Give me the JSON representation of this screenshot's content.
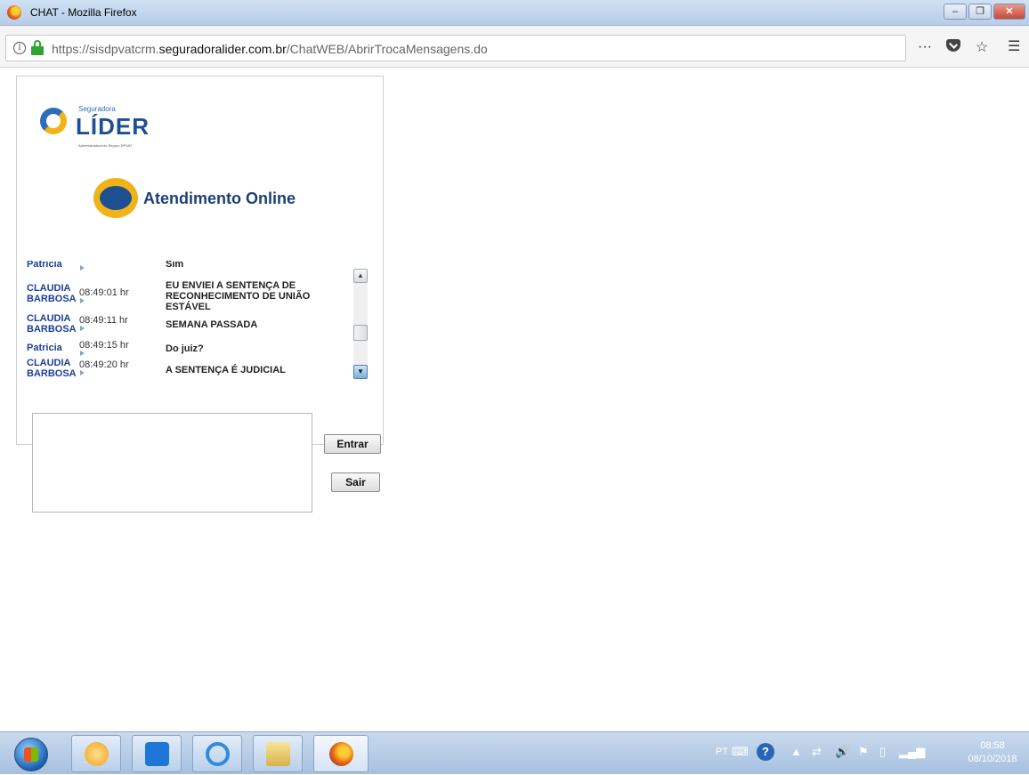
{
  "window": {
    "title": "CHAT - Mozilla Firefox",
    "minimize": "–",
    "maximize": "❐",
    "close": "✕"
  },
  "address_bar": {
    "url_prefix": "https://sisdpvatcrm.",
    "url_domain": "seguradoralider.com.br",
    "url_path": "/ChatWEB/AbrirTrocaMensagens.do",
    "more": "···",
    "star": "☆",
    "menu": "☰"
  },
  "logo": {
    "small": "Seguradora",
    "big": "LÍDER",
    "tag": "Administradora do Seguro DPVAT"
  },
  "heading": "Atendimento Online",
  "messages": [
    {
      "sender": "Patricia",
      "time": "",
      "text": "Sim"
    },
    {
      "sender": "CLAUDIA BARBOSA",
      "time": "08:49:01 hr",
      "text": "EU ENVIEI A SENTENÇA DE RECONHECIMENTO DE UNIÃO ESTÁVEL"
    },
    {
      "sender": "CLAUDIA BARBOSA",
      "time": "08:49:11 hr",
      "text": "SEMANA PASSADA"
    },
    {
      "sender": "Patricia",
      "time": "08:49:15 hr",
      "text": "Do juiz?"
    },
    {
      "sender": "CLAUDIA BARBOSA",
      "time": "08:49:20 hr",
      "text": "A SENTENÇA É JUDICIAL"
    }
  ],
  "buttons": {
    "enter": "Entrar",
    "exit": "Sair"
  },
  "taskbar": {
    "lang": "PT",
    "clock_time": "08:58",
    "clock_date": "08/10/2018"
  }
}
